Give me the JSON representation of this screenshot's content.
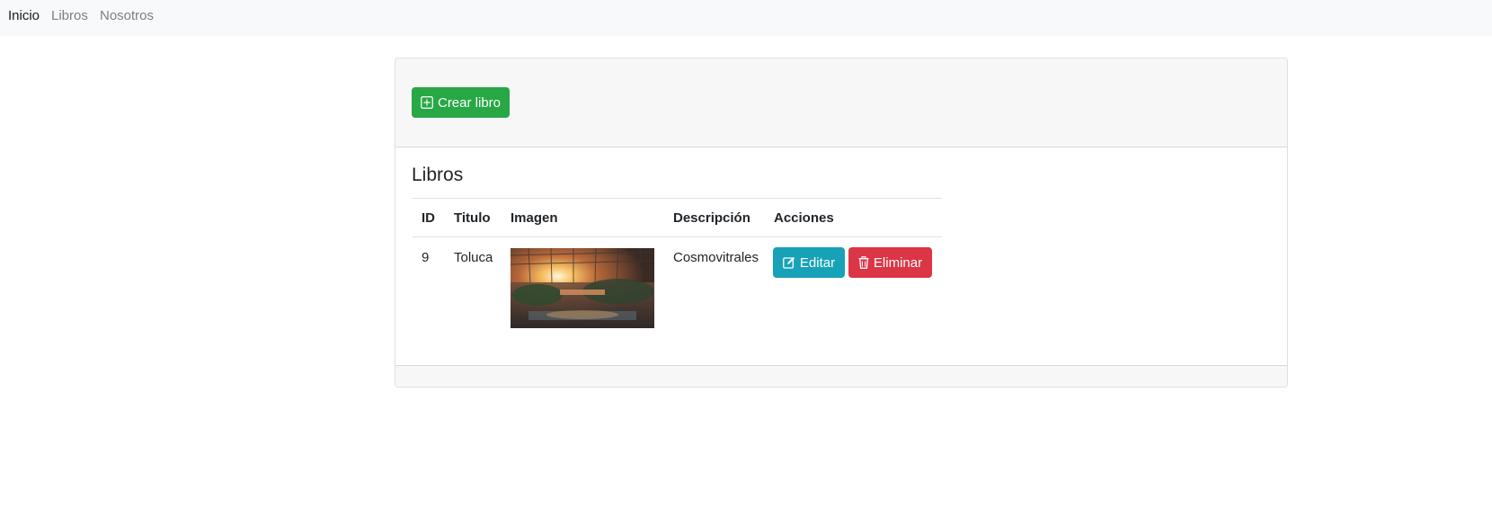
{
  "nav": {
    "items": [
      {
        "label": "Inicio",
        "active": true
      },
      {
        "label": "Libros",
        "active": false
      },
      {
        "label": "Nosotros",
        "active": false
      }
    ]
  },
  "card": {
    "create_button": {
      "label": "Crear libro",
      "icon": "plus-square-icon"
    },
    "title": "Libros",
    "table": {
      "headers": [
        "ID",
        "Titulo",
        "Imagen",
        "Descripción",
        "Acciones"
      ],
      "rows": [
        {
          "id": "9",
          "titulo": "Toluca",
          "imagen": "greenhouse-sunset-photo",
          "descripcion": "Cosmovitrales",
          "actions": {
            "edit": {
              "label": "Editar",
              "icon": "edit-icon"
            },
            "delete": {
              "label": "Eliminar",
              "icon": "trash-icon"
            }
          }
        }
      ]
    }
  },
  "colors": {
    "success": "#28a745",
    "info": "#17a2b8",
    "danger": "#dc3545",
    "navbar_bg": "#f8f9fa",
    "card_header_bg": "#f7f7f7"
  }
}
